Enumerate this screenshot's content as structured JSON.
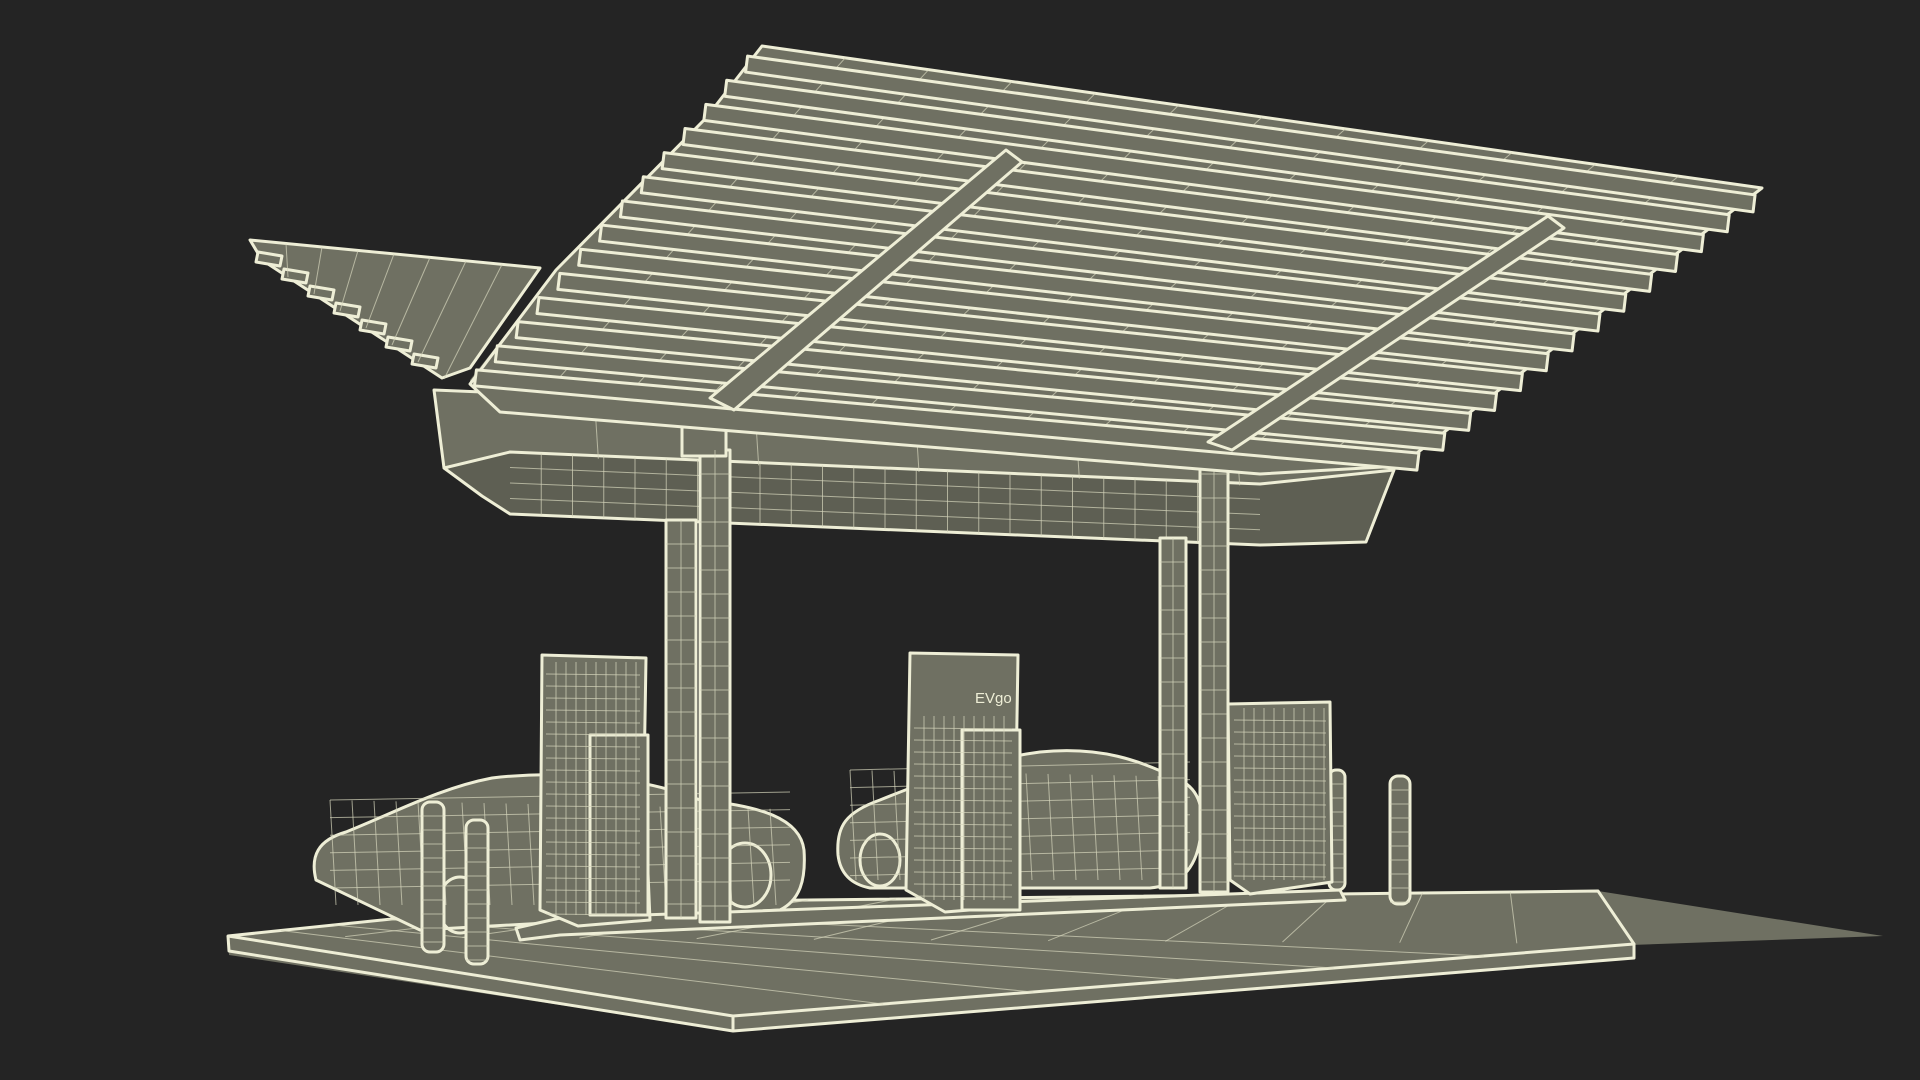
{
  "scene": {
    "background": "#242424",
    "wire_color": "#eeeed6",
    "surface_color": "#6f7062",
    "charger_logo": "EVgo"
  }
}
